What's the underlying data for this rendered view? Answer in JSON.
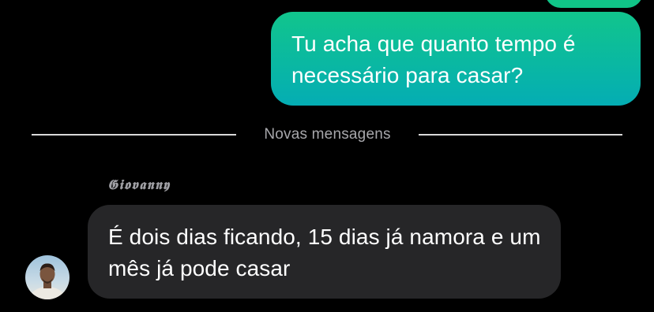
{
  "thread": {
    "outgoing_message": "Tu acha que quanto tempo é necessário para casar?",
    "divider_label": "Novas mensagens",
    "incoming": {
      "sender_name": "𝕲𝖎𝖔𝖛𝖆𝖓𝖓𝖞",
      "message": "É dois dias ficando, 15 dias já namora e um mês já pode casar"
    }
  },
  "colors": {
    "background": "#000000",
    "outgoing_bubble_top": "#11c58c",
    "outgoing_bubble_bottom": "#04adb4",
    "incoming_bubble": "#262628",
    "divider_text": "#a7a7ab"
  }
}
